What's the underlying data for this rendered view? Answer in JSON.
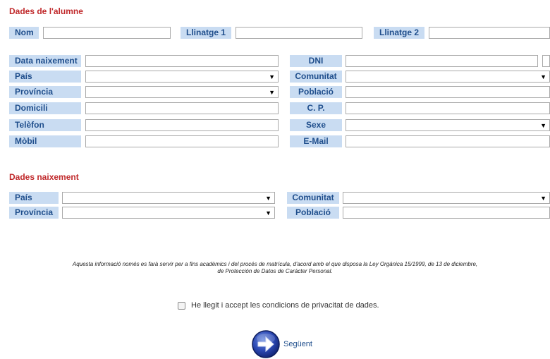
{
  "student": {
    "title": "Dades de l'alumne",
    "fields": {
      "nom": "Nom",
      "llinatge1": "Llinatge 1",
      "llinatge2": "Llinatge 2",
      "data_naixement": "Data naixement",
      "pais": "País",
      "provincia": "Província",
      "domicili": "Domicili",
      "telefon": "Telèfon",
      "mobil": "Mòbil",
      "dni": "DNI",
      "comunitat": "Comunitat",
      "poblacio": "Població",
      "cp": "C. P.",
      "sexe": "Sexe",
      "email": "E-Mail"
    }
  },
  "birth": {
    "title": "Dades naixement",
    "fields": {
      "pais": "País",
      "provincia": "Província",
      "comunitat": "Comunitat",
      "poblacio": "Població"
    }
  },
  "notice": {
    "line1": "Aquesta informació només es farà servir per a fins acadèmics i del procés de matrícula, d'acord amb el que disposa la Ley Orgánica 15/1999, de 13 de diciembre,",
    "line2": "de Protección de Datos de Carácter Personal."
  },
  "privacy": {
    "label": "He llegit i accept les condicions de privacitat de dades."
  },
  "next": {
    "label": "Següent"
  },
  "icons": {
    "dropdown": "dropdown-arrow-icon",
    "next": "arrow-right-circle-icon"
  },
  "colors": {
    "section_title": "#c0292b",
    "label_bg": "#c9dcf2",
    "label_text": "#1f4e8c"
  }
}
